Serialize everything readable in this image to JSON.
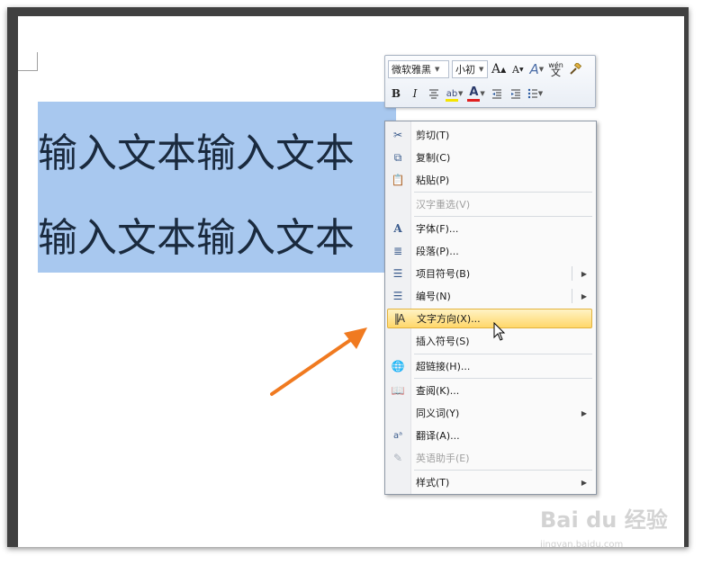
{
  "document": {
    "line1": "输入文本输入文本",
    "line2": "输入文本输入文本"
  },
  "mini_toolbar": {
    "font_name": "微软雅黑",
    "font_size": "小初",
    "grow_font": "A",
    "shrink_font": "A",
    "styles": "A",
    "phonetic": "wén",
    "bold": "B",
    "italic": "I",
    "font_color": "A"
  },
  "context_menu": {
    "items": [
      {
        "label": "剪切(T)",
        "icon": "scissors-icon"
      },
      {
        "label": "复制(C)",
        "icon": "copy-icon"
      },
      {
        "label": "粘贴(P)",
        "icon": "paste-icon"
      },
      {
        "label": "汉字重选(V)",
        "disabled": true
      },
      {
        "label": "字体(F)...",
        "icon": "font-icon"
      },
      {
        "label": "段落(P)...",
        "icon": "paragraph-icon"
      },
      {
        "label": "项目符号(B)",
        "icon": "bullets-icon",
        "submenu": true
      },
      {
        "label": "编号(N)",
        "icon": "numbering-icon",
        "submenu": true
      },
      {
        "label": "文字方向(X)...",
        "icon": "text-direction-icon",
        "highlighted": true
      },
      {
        "label": "插入符号(S)"
      },
      {
        "label": "超链接(H)...",
        "icon": "hyperlink-icon"
      },
      {
        "label": "查阅(K)...",
        "icon": "research-icon"
      },
      {
        "label": "同义词(Y)",
        "submenu": true
      },
      {
        "label": "翻译(A)...",
        "icon": "translate-icon"
      },
      {
        "label": "英语助手(E)",
        "icon": "english-assistant-icon",
        "disabled": true
      },
      {
        "label": "样式(T)",
        "submenu": true
      }
    ]
  },
  "watermark": {
    "logo_text": "Bai du 经验",
    "url": "jingyan.baidu.com"
  },
  "colors": {
    "selection": "#a8c8ef",
    "highlight": "#ffd76a",
    "arrow": "#f07a20",
    "font_color_bar": "#e02020",
    "highlight_bar": "#f5e400"
  }
}
